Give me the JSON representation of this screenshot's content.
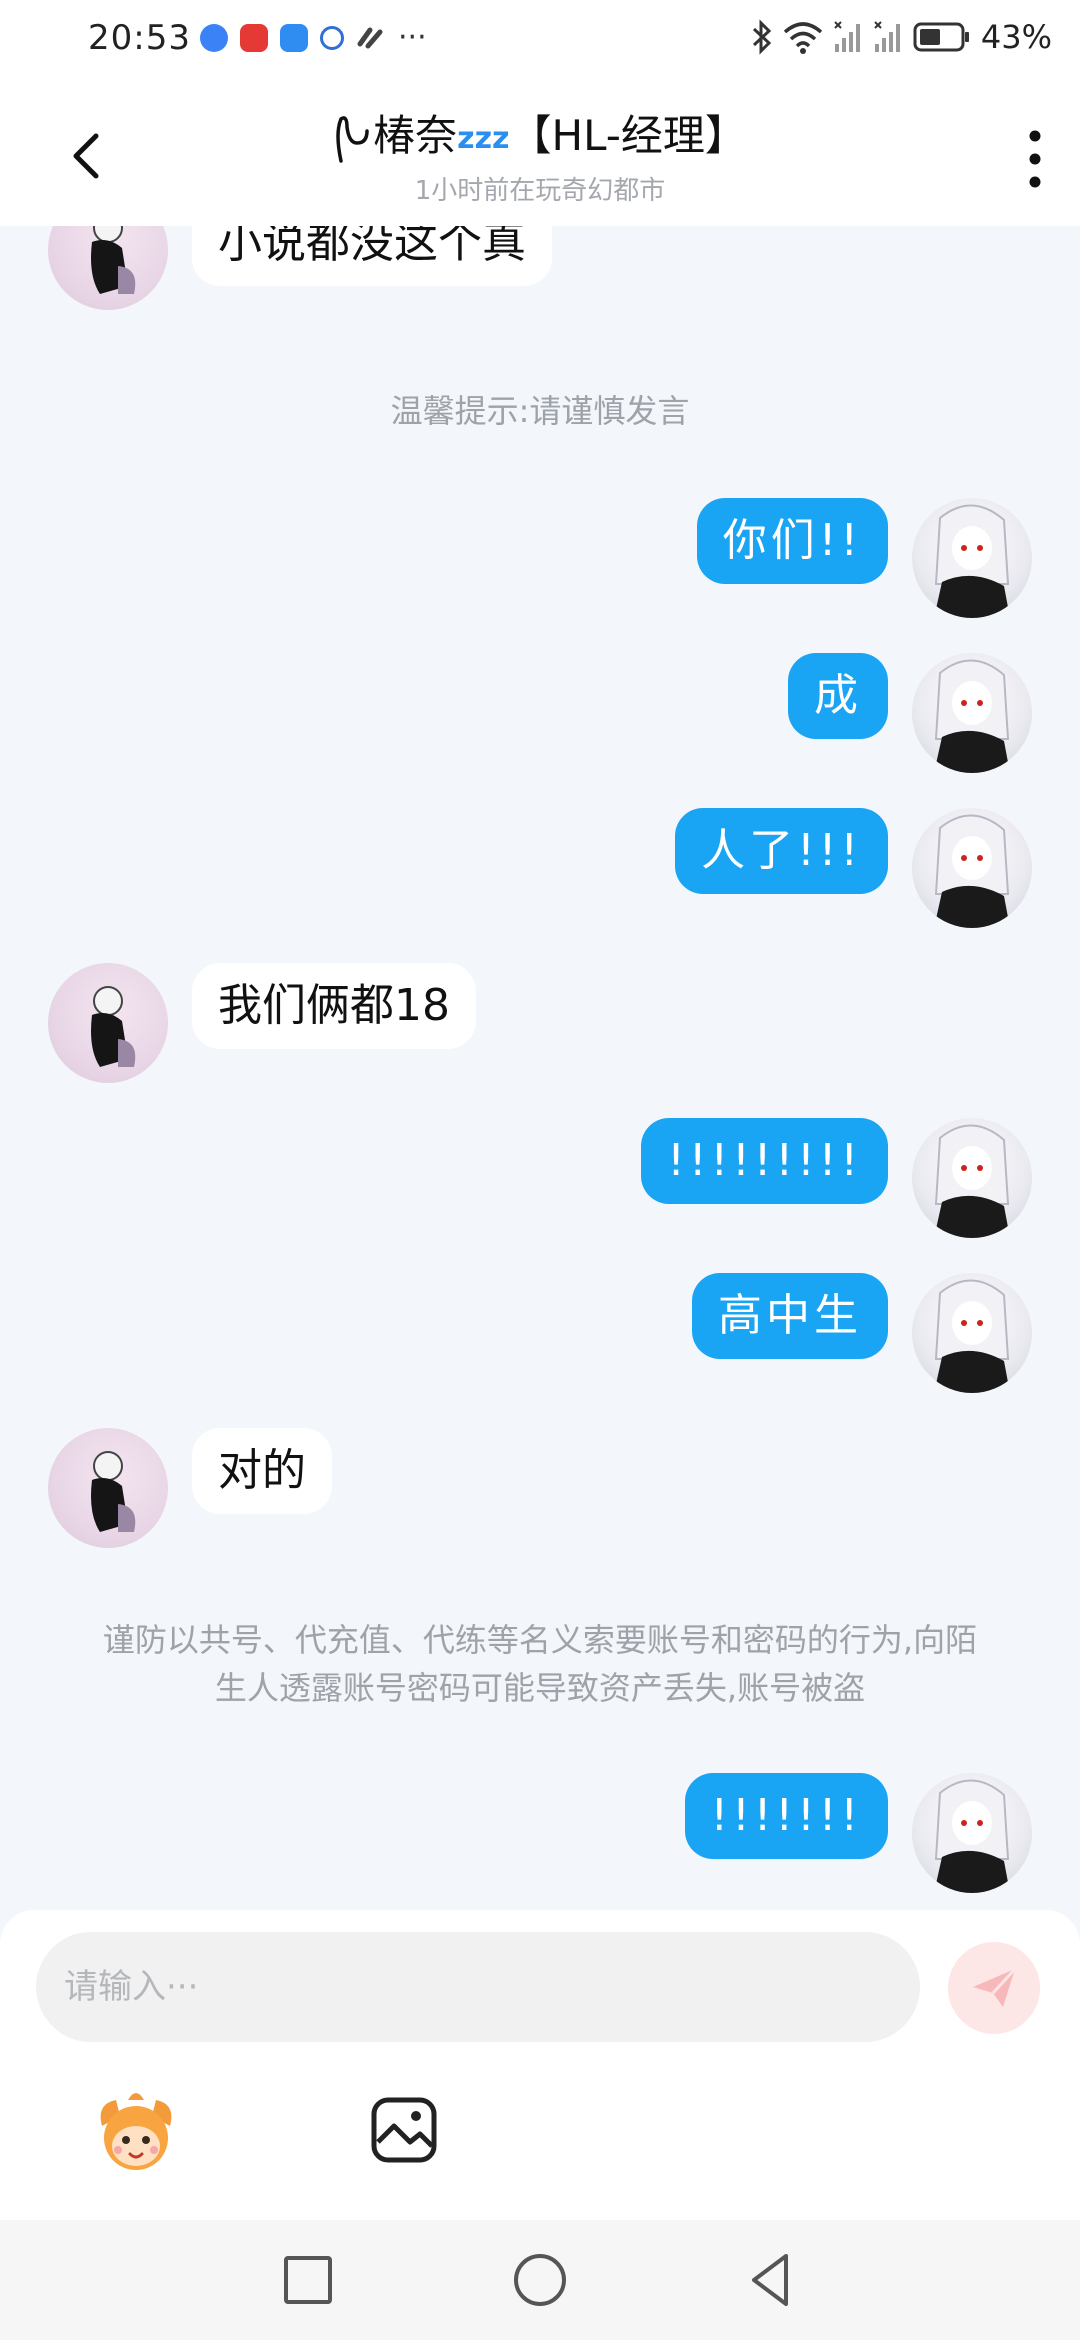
{
  "status_bar": {
    "time": "20:53",
    "more": "···",
    "battery": "43%"
  },
  "header": {
    "title": "椿奈",
    "zzz": "zzz",
    "tag": "【HL-经理】",
    "subtitle": "1小时前在玩奇幻都市"
  },
  "messages": [
    {
      "side": "left",
      "text": "小说都没这个真"
    },
    {
      "side": "system",
      "text": "温馨提示:请谨慎发言"
    },
    {
      "side": "right",
      "text": "你们!!"
    },
    {
      "side": "right",
      "text": "成"
    },
    {
      "side": "right",
      "text": "人了!!!"
    },
    {
      "side": "left",
      "text": "我们俩都18"
    },
    {
      "side": "right",
      "text": "!!!!!!!!!"
    },
    {
      "side": "right",
      "text": "高中生"
    },
    {
      "side": "left",
      "text": "对的"
    },
    {
      "side": "warning",
      "text": "谨防以共号、代充值、代练等名义索要账号和密码的行为,向陌生人透露账号密码可能导致资产丢失,账号被盗"
    },
    {
      "side": "right",
      "text": "!!!!!!!"
    }
  ],
  "input": {
    "placeholder": "请输入···"
  },
  "colors": {
    "accent": "#1aa4f4",
    "background": "#f3f6fa",
    "send_disabled": "#fde6e6"
  },
  "icons": {
    "back": "chevron-left-icon",
    "more": "more-vertical-icon",
    "send": "paper-plane-icon",
    "emoji": "mascot-emoji-icon",
    "image": "image-icon"
  }
}
